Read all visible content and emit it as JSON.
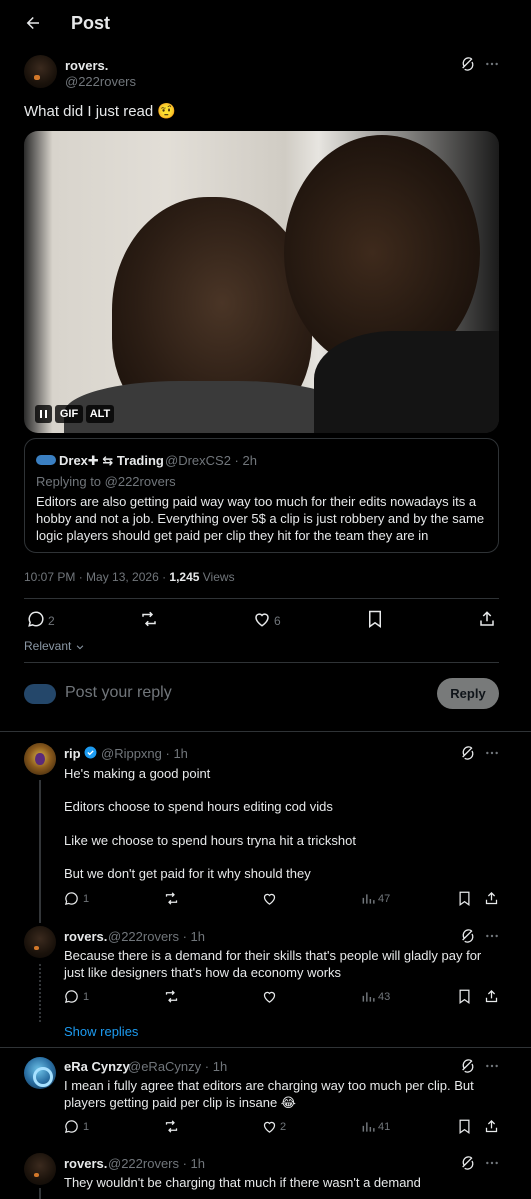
{
  "header": {
    "title": "Post"
  },
  "post": {
    "name": "rovers.",
    "handle": "@222rovers",
    "text": "What did I just read 🤨",
    "gif_label": "GIF",
    "alt_label": "ALT",
    "quote": {
      "name": "Drex✚ ⇆ Trading",
      "handle": "@DrexCS2 · 2h",
      "replying_to": "Replying to @222rovers",
      "text": "Editors are also getting paid way way too much for their edits nowadays its a hobby and not a job. Everything over 5$ a clip is just robbery and by the same logic players should get paid per clip they hit for the team they are in"
    },
    "time": "10:07 PM · May 13, 2026 · ",
    "views_count": "1,245",
    "views_label": " Views",
    "replies": "2",
    "likes": "6",
    "sort_label": "Relevant",
    "reply_placeholder": "Post your reply",
    "reply_button": "Reply"
  },
  "replies": [
    {
      "name": "rip",
      "handle": "@Rippxng · 1h",
      "lines": [
        "He's making a good point",
        "Editors choose to spend hours editing cod vids",
        "Like we choose to spend hours tryna hit a trickshot",
        "But we don't get paid for it why should they"
      ],
      "replies": "1",
      "likes": "",
      "views": "47"
    },
    {
      "name": "rovers.",
      "handle": "@222rovers · 1h",
      "text": "Because there is a demand for their skills that's people will gladly pay for just like designers that's how da economy works",
      "replies": "1",
      "likes": "",
      "views": "43",
      "show_replies": "Show replies"
    },
    {
      "name": "eRa Cynzy",
      "handle": "@eRaCynzy · 1h",
      "text": "I mean i fully agree that editors are charging way too much per clip. But players getting paid per clip is insane 😂",
      "replies": "1",
      "likes": "2",
      "views": "41"
    },
    {
      "name": "rovers.",
      "handle": "@222rovers · 1h",
      "text": "They wouldn't be charging that much if there wasn't a demand"
    }
  ],
  "icons": [
    "back-arrow-icon",
    "grok-icon",
    "more-icon",
    "reply-icon",
    "repost-icon",
    "like-icon",
    "bookmark-icon",
    "share-icon",
    "views-icon",
    "verified-icon",
    "pause-icon",
    "chevron-down-icon"
  ],
  "colors": {
    "background": "#000000",
    "text": "#e7e9ea",
    "muted": "#71767b",
    "border": "#2f3336",
    "link": "#1d9bf0",
    "verified": "#1d9bf0"
  }
}
